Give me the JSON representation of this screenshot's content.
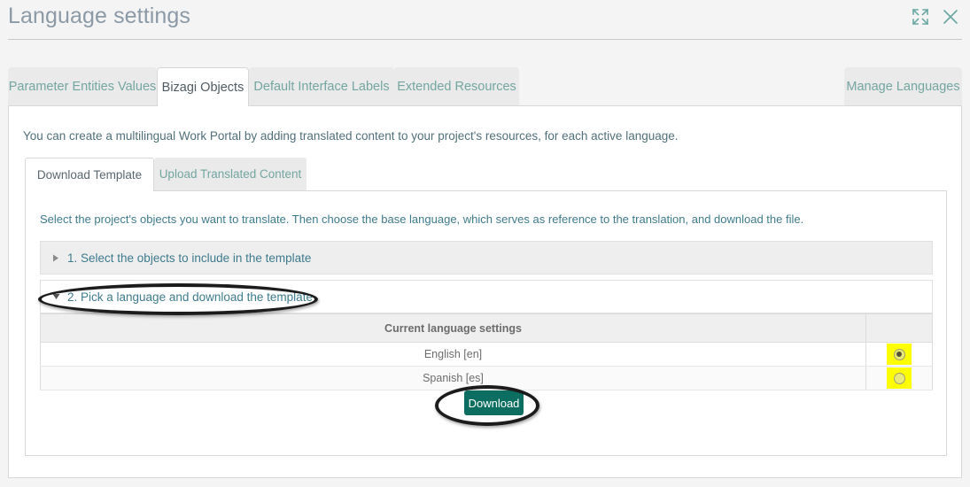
{
  "window": {
    "title": "Language settings",
    "expand_icon": "expand-arrows-icon",
    "close_icon": "close-icon"
  },
  "outer_tabs": [
    {
      "id": "parameter-entities-values",
      "label": "Parameter Entities Values",
      "active": false
    },
    {
      "id": "bizagi-objects",
      "label": "Bizagi Objects",
      "active": true
    },
    {
      "id": "default-interface-labels",
      "label": "Default Interface Labels",
      "active": false
    },
    {
      "id": "extended-resources",
      "label": "Extended Resources",
      "active": false
    },
    {
      "id": "manage-languages",
      "label": "Manage Languages",
      "active": false
    }
  ],
  "content": {
    "intro_text": "You can create a multilingual Work Portal by adding translated content to your project's resources, for each active language.",
    "select_text": "Select the project's objects you want to translate. Then choose the base language, which serves as reference to the translation, and download the file."
  },
  "inner_tabs": [
    {
      "id": "download-template",
      "label": "Download Template",
      "active": true
    },
    {
      "id": "upload-translated-content",
      "label": "Upload Translated Content",
      "active": false
    }
  ],
  "accordions": [
    {
      "id": "select-objects",
      "label": "1. Select the objects to include in the template",
      "expanded": false,
      "arrow": "chevron-right-icon"
    },
    {
      "id": "pick-language",
      "label": "2. Pick a language and download the template",
      "expanded": true,
      "arrow": "chevron-down-icon"
    }
  ],
  "language_table": {
    "header": "Current language settings",
    "rows": [
      {
        "name": "English [en]",
        "selected": true
      },
      {
        "name": "Spanish [es]",
        "selected": false
      }
    ]
  },
  "download_button": {
    "label": "Download"
  },
  "colors": {
    "accent_teal": "#0b6e60",
    "link_teal": "#3e7b8d",
    "tab_teal": "#73a6a1",
    "title_gray": "#8b9aa6",
    "highlight_yellow": "#ffff00",
    "annotation_black": "#1c1c1c"
  }
}
